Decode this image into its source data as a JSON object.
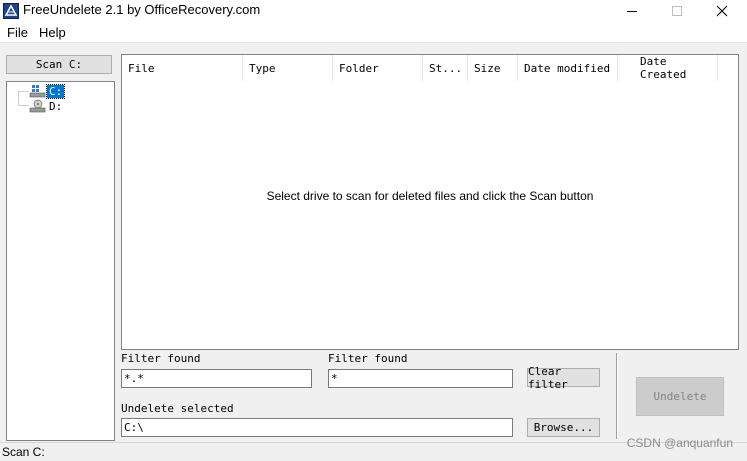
{
  "window": {
    "title": "FreeUndelete 2.1 by OfficeRecovery.com"
  },
  "menu": {
    "file": "File",
    "help": "Help"
  },
  "toolbar": {
    "scan_label": "Scan C:"
  },
  "drives": [
    {
      "label": "C:",
      "selected": true,
      "icon": "network-drive-icon"
    },
    {
      "label": "D:",
      "selected": false,
      "icon": "hard-drive-icon"
    }
  ],
  "file_list": {
    "columns": [
      "File",
      "Type",
      "Folder",
      "St...",
      "Size",
      "Date modified",
      "Date Created"
    ],
    "empty_message": "Select drive to scan for deleted files and click the Scan button"
  },
  "filters": {
    "filter1_label": "Filter found",
    "filter1_value": "*.*",
    "filter2_label": "Filter found",
    "filter2_value": "*",
    "clear_label": "Clear filter"
  },
  "undelete": {
    "label": "Undelete selected",
    "path_value": "C:\\",
    "browse_label": "Browse...",
    "undelete_label": "Undelete"
  },
  "status": {
    "text": "Scan C:"
  },
  "watermark": "CSDN @anquanfun",
  "colors": {
    "selection": "#0078d7",
    "window_bg": "#f0f0f0",
    "disabled_text": "#838383"
  }
}
